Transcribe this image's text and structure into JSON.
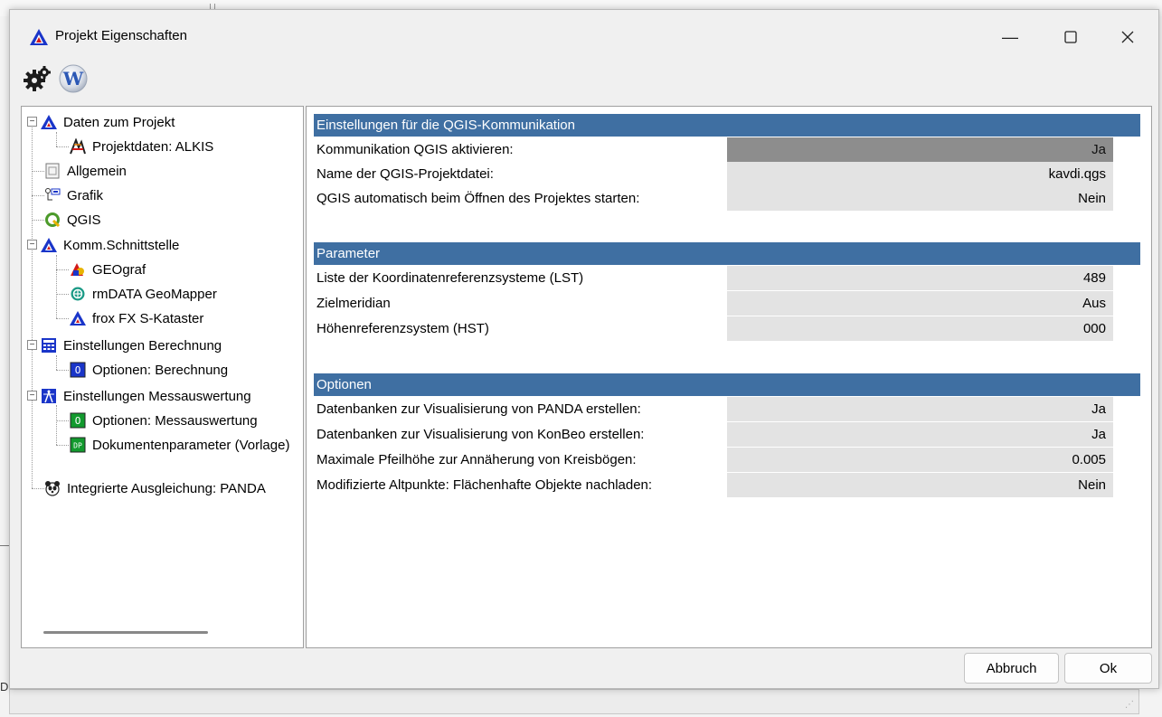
{
  "window": {
    "title": "Projekt Eigenschaften",
    "minimize_glyph": "—",
    "maximize_glyph": "☐",
    "close_glyph": "✕"
  },
  "toolbar": {
    "settings_icon": "gear-icon",
    "word_icon": "w-logo-icon",
    "word_glyph": "W"
  },
  "tree": {
    "selected": "QGIS",
    "items": [
      {
        "label": "Daten zum Projekt",
        "icon": "blue-triangle-icon",
        "level": 0,
        "expanded": true
      },
      {
        "label": "Projektdaten: ALKIS",
        "icon": "alkis-icon",
        "level": 1
      },
      {
        "label": "Allgemein",
        "icon": "page-icon",
        "level": 0
      },
      {
        "label": "Grafik",
        "icon": "graphic-icon",
        "level": 0
      },
      {
        "label": "QGIS",
        "icon": "qgis-icon",
        "level": 0
      },
      {
        "label": "Komm.Schnittstelle",
        "icon": "blue-triangle-icon",
        "level": 0,
        "expanded": true
      },
      {
        "label": "GEOgraf",
        "icon": "geograf-icon",
        "level": 1
      },
      {
        "label": "rmDATA GeoMapper",
        "icon": "geomapper-icon",
        "level": 1
      },
      {
        "label": "frox FX S-Kataster",
        "icon": "blue-triangle-icon",
        "level": 1
      },
      {
        "label": "Einstellungen Berechnung",
        "icon": "calculator-icon",
        "level": 0,
        "expanded": true
      },
      {
        "label": "Optionen: Berechnung",
        "icon": "blue-o-icon",
        "level": 1,
        "glyph": "O"
      },
      {
        "label": "Einstellungen Messauswertung",
        "icon": "survey-icon",
        "level": 0,
        "expanded": true
      },
      {
        "label": "Optionen: Messauswertung",
        "icon": "green-o-icon",
        "level": 1,
        "glyph": "O"
      },
      {
        "label": "Dokumentenparameter (Vorlage)",
        "icon": "dp-icon",
        "level": 1,
        "glyph": "DP"
      },
      {
        "label": "Integrierte Ausgleichung: PANDA",
        "icon": "panda-icon",
        "level": 0
      }
    ]
  },
  "sections": [
    {
      "title": "Einstellungen für die QGIS-Kommunikation",
      "rows": [
        {
          "name": "Kommunikation QGIS aktivieren:",
          "value": "Ja",
          "active": true
        },
        {
          "name": "Name der QGIS-Projektdatei:",
          "value": "kavdi.qgs"
        },
        {
          "name": "QGIS automatisch beim Öffnen des Projektes starten:",
          "value": "Nein"
        }
      ]
    },
    {
      "title": "Parameter",
      "rows": [
        {
          "name": "Liste der Koordinatenreferenzsysteme (LST)",
          "value": "489"
        },
        {
          "name": "Zielmeridian",
          "value": "Aus"
        },
        {
          "name": "Höhenreferenzsystem (HST)",
          "value": "000"
        }
      ]
    },
    {
      "title": "Optionen",
      "rows": [
        {
          "name": "Datenbanken zur Visualisierung von PANDA erstellen:",
          "value": "Ja"
        },
        {
          "name": "Datenbanken zur Visualisierung von KonBeo erstellen:",
          "value": "Ja"
        },
        {
          "name": "Maximale Pfeilhöhe zur Annäherung von Kreisbögen:",
          "value": "0.005"
        },
        {
          "name": "Modifizierte Altpunkte: Flächenhafte Objekte nachladen:",
          "value": "Nein"
        }
      ]
    }
  ],
  "buttons": {
    "cancel": "Abbruch",
    "ok": "Ok"
  },
  "background": {
    "edge_letter": "D"
  },
  "colors": {
    "section_header": "#3f6fa2",
    "value_cell": "#e3e3e3",
    "value_cell_active": "#8d8d8d",
    "accent_blue": "#1a35c9"
  }
}
